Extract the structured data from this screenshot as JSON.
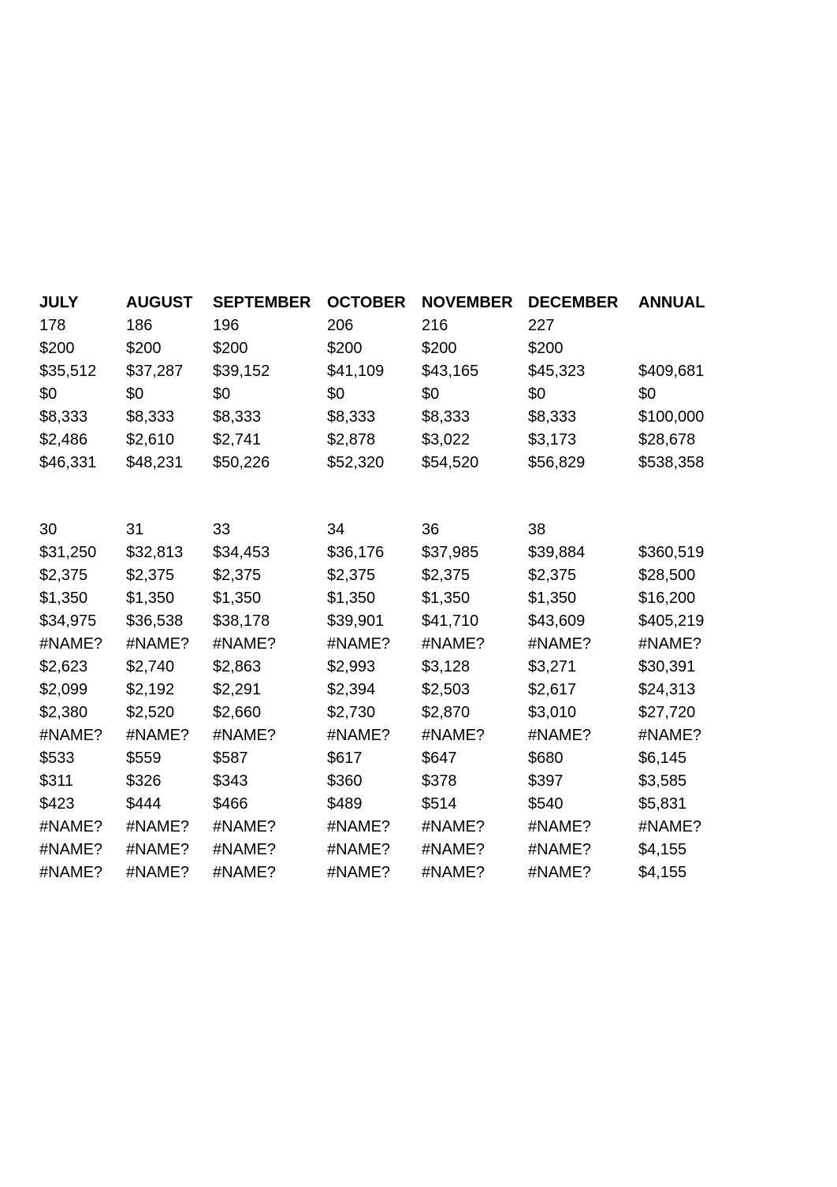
{
  "headers": {
    "jul": "JULY",
    "aug": "AUGUST",
    "sep": "SEPTEMBER",
    "oct": "OCTOBER",
    "nov": "NOVEMBER",
    "dec": "DECEMBER",
    "ann": "ANNUAL"
  },
  "block1": [
    {
      "jul": "178",
      "aug": "186",
      "sep": "196",
      "oct": "206",
      "nov": "216",
      "dec": "227",
      "ann": ""
    },
    {
      "jul": "$200",
      "aug": "$200",
      "sep": "$200",
      "oct": "$200",
      "nov": "$200",
      "dec": "$200",
      "ann": ""
    },
    {
      "jul": "$35,512",
      "aug": "$37,287",
      "sep": "$39,152",
      "oct": "$41,109",
      "nov": "$43,165",
      "dec": "$45,323",
      "ann": "$409,681"
    },
    {
      "jul": "$0",
      "aug": "$0",
      "sep": "$0",
      "oct": "$0",
      "nov": "$0",
      "dec": "$0",
      "ann": "$0"
    },
    {
      "jul": "$8,333",
      "aug": "$8,333",
      "sep": "$8,333",
      "oct": "$8,333",
      "nov": "$8,333",
      "dec": "$8,333",
      "ann": "$100,000"
    },
    {
      "jul": "$2,486",
      "aug": "$2,610",
      "sep": "$2,741",
      "oct": "$2,878",
      "nov": "$3,022",
      "dec": "$3,173",
      "ann": "$28,678"
    },
    {
      "jul": "$46,331",
      "aug": "$48,231",
      "sep": "$50,226",
      "oct": "$52,320",
      "nov": "$54,520",
      "dec": "$56,829",
      "ann": "$538,358"
    }
  ],
  "block2": [
    {
      "jul": "30",
      "aug": "31",
      "sep": "33",
      "oct": "34",
      "nov": "36",
      "dec": "38",
      "ann": ""
    },
    {
      "jul": "$31,250",
      "aug": "$32,813",
      "sep": "$34,453",
      "oct": "$36,176",
      "nov": "$37,985",
      "dec": "$39,884",
      "ann": "$360,519"
    },
    {
      "jul": "$2,375",
      "aug": "$2,375",
      "sep": "$2,375",
      "oct": "$2,375",
      "nov": "$2,375",
      "dec": "$2,375",
      "ann": "$28,500"
    },
    {
      "jul": "$1,350",
      "aug": "$1,350",
      "sep": "$1,350",
      "oct": "$1,350",
      "nov": "$1,350",
      "dec": "$1,350",
      "ann": "$16,200"
    },
    {
      "jul": "$34,975",
      "aug": "$36,538",
      "sep": "$38,178",
      "oct": "$39,901",
      "nov": "$41,710",
      "dec": "$43,609",
      "ann": "$405,219"
    },
    {
      "jul": "#NAME?",
      "aug": "#NAME?",
      "sep": "#NAME?",
      "oct": "#NAME?",
      "nov": "#NAME?",
      "dec": "#NAME?",
      "ann": "#NAME?"
    },
    {
      "jul": "$2,623",
      "aug": "$2,740",
      "sep": "$2,863",
      "oct": "$2,993",
      "nov": "$3,128",
      "dec": "$3,271",
      "ann": "$30,391"
    },
    {
      "jul": "$2,099",
      "aug": "$2,192",
      "sep": "$2,291",
      "oct": "$2,394",
      "nov": "$2,503",
      "dec": "$2,617",
      "ann": "$24,313"
    },
    {
      "jul": "$2,380",
      "aug": "$2,520",
      "sep": "$2,660",
      "oct": "$2,730",
      "nov": "$2,870",
      "dec": "$3,010",
      "ann": "$27,720"
    },
    {
      "jul": "#NAME?",
      "aug": "#NAME?",
      "sep": "#NAME?",
      "oct": "#NAME?",
      "nov": "#NAME?",
      "dec": "#NAME?",
      "ann": "#NAME?"
    },
    {
      "jul": "$533",
      "aug": "$559",
      "sep": "$587",
      "oct": "$617",
      "nov": "$647",
      "dec": "$680",
      "ann": "$6,145"
    },
    {
      "jul": "$311",
      "aug": "$326",
      "sep": "$343",
      "oct": "$360",
      "nov": "$378",
      "dec": "$397",
      "ann": "$3,585"
    },
    {
      "jul": "$423",
      "aug": "$444",
      "sep": "$466",
      "oct": "$489",
      "nov": "$514",
      "dec": "$540",
      "ann": "$5,831"
    },
    {
      "jul": "#NAME?",
      "aug": "#NAME?",
      "sep": "#NAME?",
      "oct": "#NAME?",
      "nov": "#NAME?",
      "dec": "#NAME?",
      "ann": "#NAME?"
    },
    {
      "jul": "#NAME?",
      "aug": "#NAME?",
      "sep": "#NAME?",
      "oct": "#NAME?",
      "nov": "#NAME?",
      "dec": "#NAME?",
      "ann": "$4,155"
    },
    {
      "jul": "#NAME?",
      "aug": "#NAME?",
      "sep": "#NAME?",
      "oct": "#NAME?",
      "nov": "#NAME?",
      "dec": "#NAME?",
      "ann": "$4,155"
    }
  ]
}
